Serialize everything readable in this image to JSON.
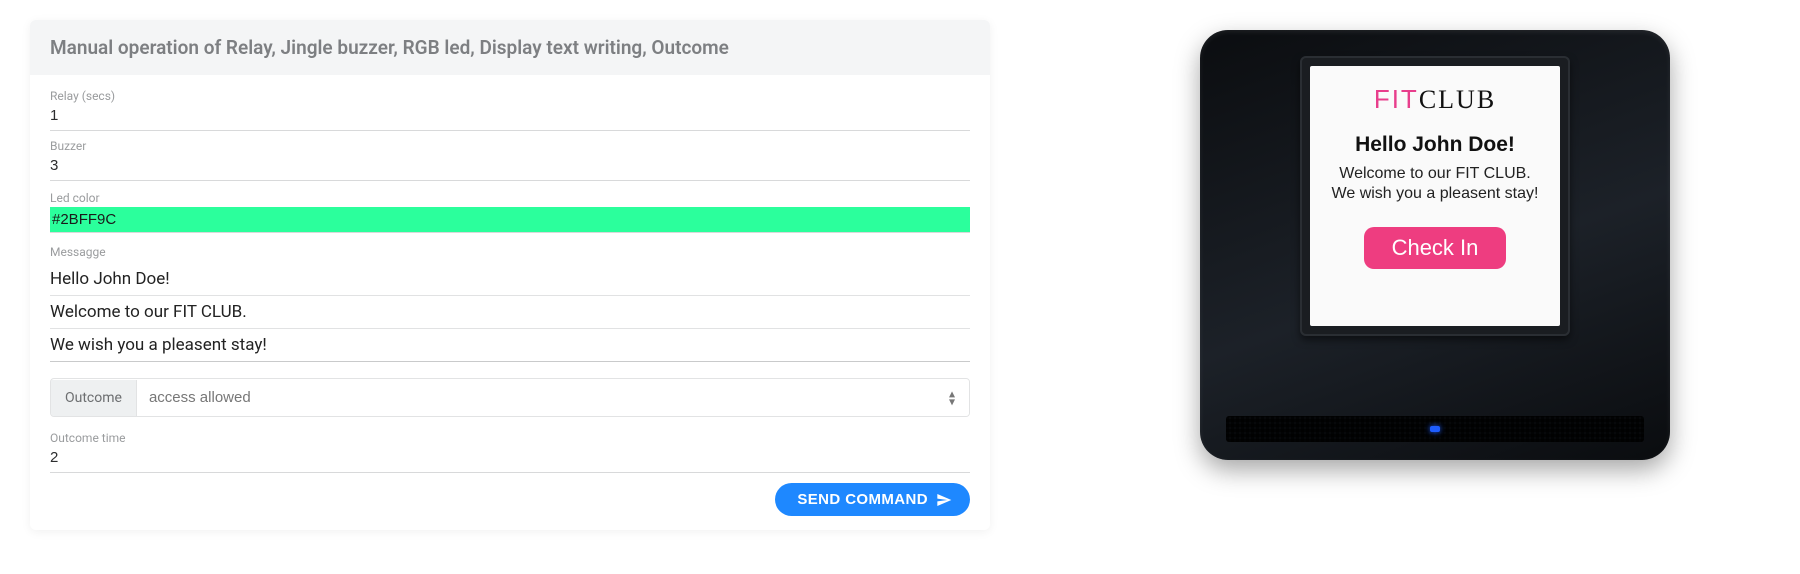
{
  "panel": {
    "title": "Manual operation of Relay, Jingle buzzer, RGB led, Display text writing, Outcome",
    "relay": {
      "label": "Relay (secs)",
      "value": "1"
    },
    "buzzer": {
      "label": "Buzzer",
      "value": "3"
    },
    "led": {
      "label": "Led color",
      "value": "#2BFF9C",
      "swatch": "#2BFF9C"
    },
    "message": {
      "label": "Messagge",
      "lines": [
        "Hello John Doe!",
        "Welcome to our FIT CLUB.",
        "We wish you a pleasent stay!"
      ]
    },
    "outcome": {
      "tag": "Outcome",
      "selected": "access allowed"
    },
    "outcome_time": {
      "label": "Outcome time",
      "value": "2"
    },
    "send_label": "SEND COMMAND"
  },
  "device": {
    "logo_fit": "FIT",
    "logo_club": "CLUB",
    "greeting": "Hello John Doe!",
    "line1": "Welcome to our FIT CLUB.",
    "line2": "We wish you a pleasent stay!",
    "checkin_label": "Check In"
  }
}
